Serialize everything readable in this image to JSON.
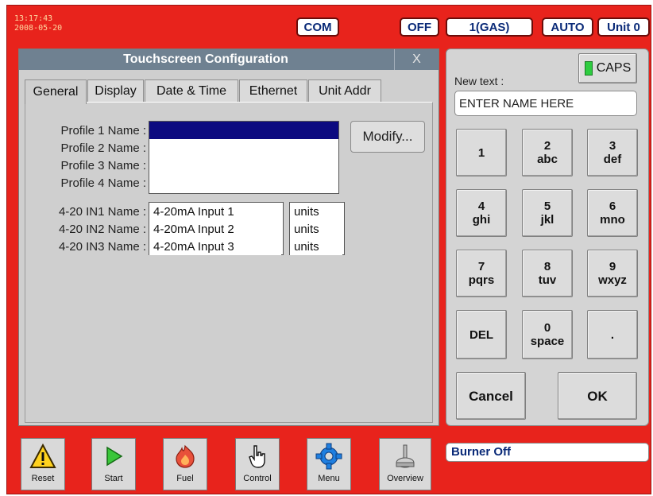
{
  "header": {
    "time": "13:17:43",
    "date": "2008-05-20",
    "com_label": "COM",
    "off_label": "OFF",
    "gas_label": "1(GAS)",
    "auto_label": "AUTO",
    "unit_label": "Unit 0"
  },
  "dialog": {
    "title": "Touchscreen Configuration",
    "close_label": "X",
    "tabs": [
      {
        "label": "General",
        "active": true
      },
      {
        "label": "Display"
      },
      {
        "label": "Date & Time"
      },
      {
        "label": "Ethernet"
      },
      {
        "label": "Unit Addr"
      }
    ],
    "profiles": [
      "Profile 1 Name :",
      "Profile 2 Name :",
      "Profile 3 Name :",
      "Profile 4 Name :"
    ],
    "modify_label": "Modify...",
    "inputs": [
      {
        "label": "4-20 IN1 Name :",
        "value": "4-20mA Input 1",
        "unit": "units"
      },
      {
        "label": "4-20 IN2 Name :",
        "value": "4-20mA Input 2",
        "unit": "units"
      },
      {
        "label": "4-20 IN3 Name :",
        "value": "4-20mA Input 3",
        "unit": "units"
      }
    ]
  },
  "keypad": {
    "caps_label": "CAPS",
    "newtext_label": "New text :",
    "text_value": "ENTER NAME HERE",
    "keys": [
      {
        "digit": "1",
        "letters": ""
      },
      {
        "digit": "2",
        "letters": "abc"
      },
      {
        "digit": "3",
        "letters": "def"
      },
      {
        "digit": "4",
        "letters": "ghi"
      },
      {
        "digit": "5",
        "letters": "jkl"
      },
      {
        "digit": "6",
        "letters": "mno"
      },
      {
        "digit": "7",
        "letters": "pqrs"
      },
      {
        "digit": "8",
        "letters": "tuv"
      },
      {
        "digit": "9",
        "letters": "wxyz"
      },
      {
        "digit": "DEL",
        "letters": ""
      },
      {
        "digit": "0",
        "letters": "space"
      },
      {
        "digit": ".",
        "letters": ""
      }
    ],
    "cancel_label": "Cancel",
    "ok_label": "OK"
  },
  "toolbar": {
    "buttons": [
      {
        "label": "Reset",
        "icon": "warning-icon"
      },
      {
        "label": "Start",
        "icon": "play-icon"
      },
      {
        "label": "Fuel",
        "icon": "flame-icon"
      },
      {
        "label": "Control",
        "icon": "hand-pointer-icon"
      },
      {
        "label": "Menu",
        "icon": "gear-icon"
      },
      {
        "label": "Overview",
        "icon": "burner-icon"
      }
    ]
  },
  "status": {
    "text": "Burner Off"
  },
  "colors": {
    "background": "#e8231c",
    "header_text": "#0a2a78",
    "selection": "#0c0a80",
    "caps_led": "#2ecc40"
  }
}
